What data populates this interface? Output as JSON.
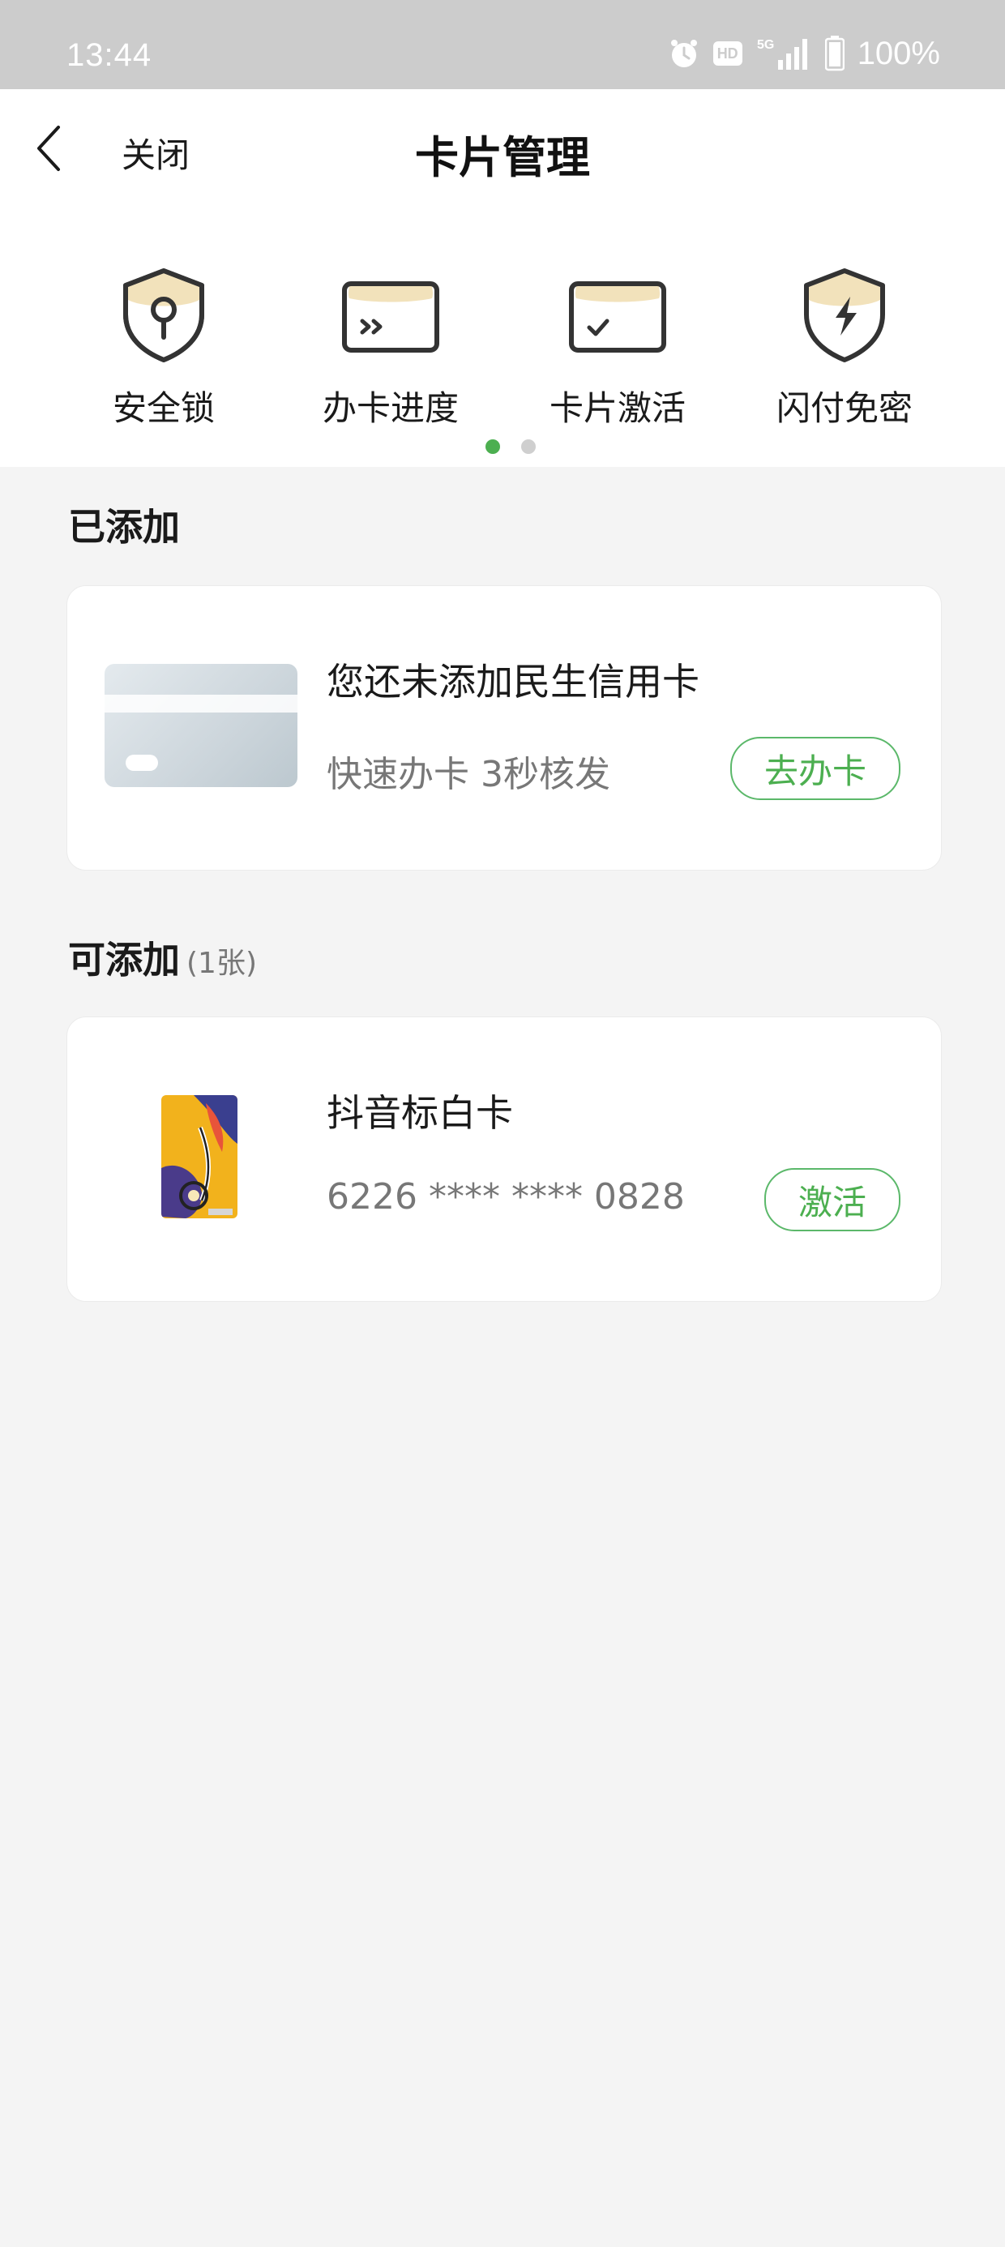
{
  "status_bar": {
    "time": "13:44",
    "battery": "100%",
    "hd_label": "HD",
    "network_label": "5G",
    "icons": [
      "alarm-icon",
      "hd-icon",
      "signal-5g-icon",
      "battery-icon"
    ]
  },
  "nav": {
    "close_label": "关闭",
    "title": "卡片管理"
  },
  "quick_actions": [
    {
      "label": "安全锁",
      "icon": "shield-lock-icon"
    },
    {
      "label": "办卡进度",
      "icon": "card-progress-icon"
    },
    {
      "label": "卡片激活",
      "icon": "card-activate-icon"
    },
    {
      "label": "闪付免密",
      "icon": "shield-flash-icon"
    }
  ],
  "pager": {
    "pages": 2,
    "active": 0
  },
  "added_section": {
    "title": "已添加",
    "card": {
      "title": "您还未添加民生信用卡",
      "subtitle": "快速办卡 3秒核发",
      "button": "去办卡"
    }
  },
  "available_section": {
    "title": "可添加",
    "count": "(1张)",
    "cards": [
      {
        "title": "抖音标白卡",
        "number": "6226 **** **** 0828",
        "button": "激活"
      }
    ]
  },
  "colors": {
    "accent_green": "#4caf50",
    "status_bar_bg": "#cccccc",
    "page_bg": "#f4f4f4",
    "icon_highlight": "#f1dfb4",
    "icon_stroke": "#333333"
  }
}
